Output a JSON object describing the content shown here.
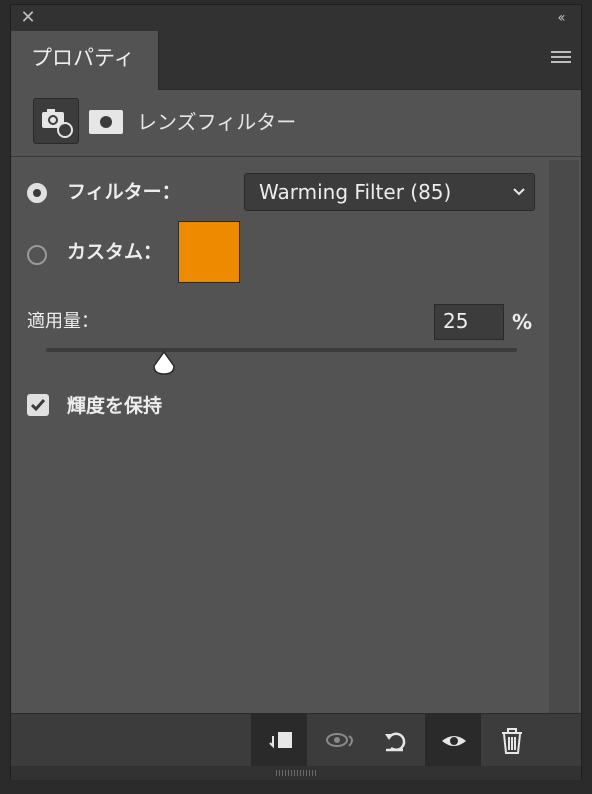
{
  "panel": {
    "tab_label": "プロパティ",
    "header_title": "レンズフィルター",
    "icons": {
      "close": "close-icon",
      "collapse": "collapse-icon",
      "menu": "panel-menu-icon",
      "adjustment": "adjustment-camera-icon",
      "mask": "mask-icon"
    }
  },
  "filter": {
    "radio_filter_label": "フィルター：",
    "radio_filter_checked": true,
    "selected_filter": "Warming Filter (85)",
    "radio_custom_label": "カスタム：",
    "radio_custom_checked": false,
    "custom_color": "#ee8a00"
  },
  "density": {
    "label": "適用量：",
    "value": "25",
    "unit": "%",
    "slider_fraction": 0.25
  },
  "preserve_luminosity": {
    "label": "輝度を保持",
    "checked": true
  },
  "footer": {
    "buttons": [
      "clip-to-layer-icon",
      "view-previous-state-icon",
      "reset-icon",
      "toggle-visibility-icon",
      "delete-icon"
    ]
  },
  "colors": {
    "panel_bg": "#535353",
    "accent_swatch": "#ee8a00"
  }
}
